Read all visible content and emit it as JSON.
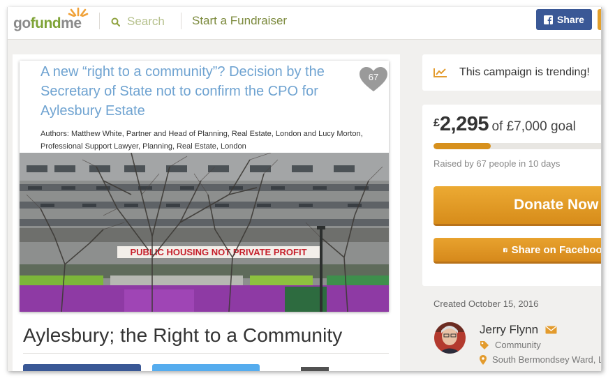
{
  "header": {
    "logo_go": "go",
    "logo_fund": "fund",
    "logo_me": "me",
    "search_placeholder": "Search",
    "start_fundraiser": "Start a Fundraiser",
    "share_label": "Share"
  },
  "campaign": {
    "image_doc_title": "A new “right to a community”? Decision by the Secretary of State not to confirm the CPO for Aylesbury Estate",
    "image_doc_authors": "Authors: Matthew White, Partner and Head of Planning, Real Estate, London and Lucy Morton, Professional Support Lawyer, Planning, Real Estate, London",
    "banner_text": "PUBLIC HOUSING NOT PRIVATE PROFIT",
    "hearts_count": "67",
    "title": "Aylesbury; the Right to a Community"
  },
  "trending": {
    "text": "This campaign is trending!"
  },
  "donation": {
    "currency": "£",
    "raised": "2,295",
    "goal_text": "of £7,000 goal",
    "progress_fraction": 0.328,
    "raised_by": "Raised by 67 people in 10 days",
    "donate_label": "Donate Now",
    "share_fb_label": "Share on Facebook"
  },
  "organizer": {
    "created": "Created October 15, 2016",
    "name": "Jerry Flynn",
    "category": "Community",
    "location": "South Bermondsey Ward, London"
  },
  "colors": {
    "brand_green": "#7ea336",
    "facebook_blue": "#3a5896",
    "donate_orange": "#e3a02c",
    "twitter_blue": "#55acee"
  },
  "icons": [
    "search-icon",
    "facebook-icon",
    "heart-icon",
    "trending-icon",
    "envelope-icon",
    "tag-icon",
    "map-pin-icon"
  ]
}
